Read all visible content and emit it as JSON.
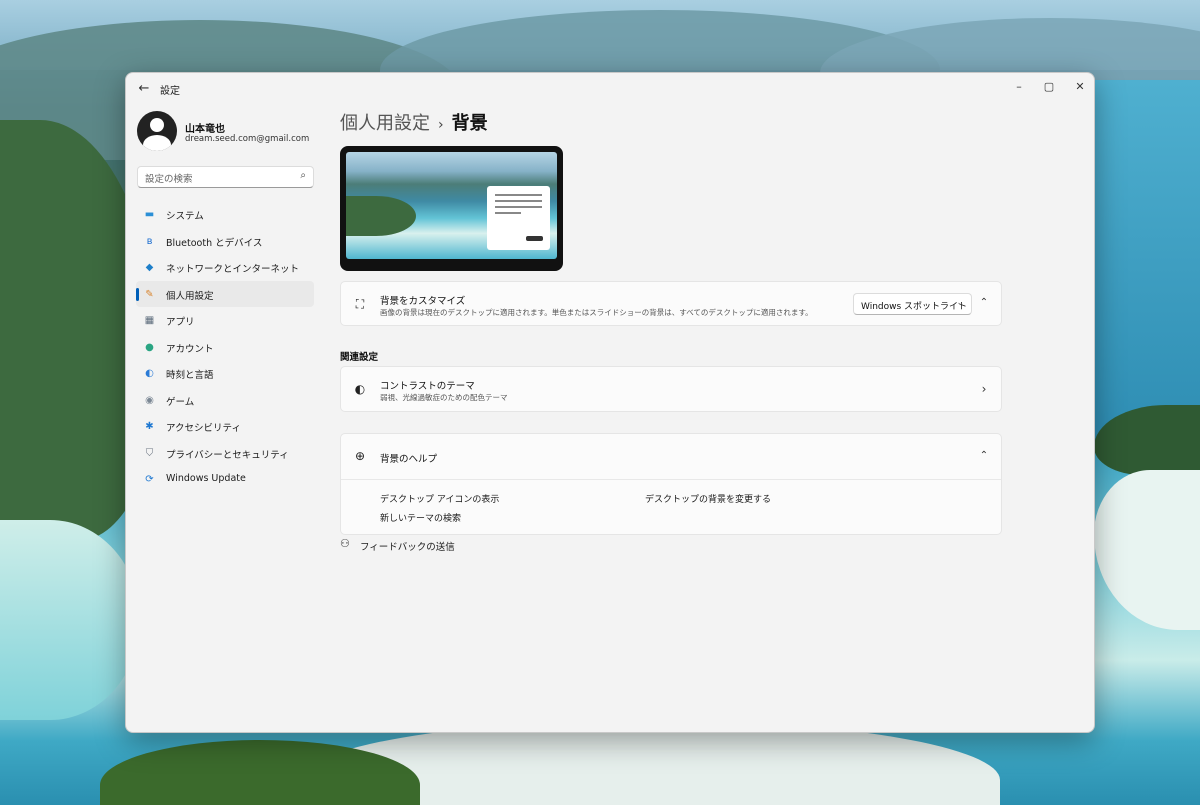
{
  "window": {
    "app_title": "設定",
    "back_glyph": "←",
    "controls": {
      "minimize": "–",
      "maximize": "▢",
      "close": "✕"
    }
  },
  "user": {
    "name": "山本竜也",
    "email": "dream.seed.com@gmail.com"
  },
  "search": {
    "placeholder": "設定の検索",
    "icon": "🔍"
  },
  "sidebar": {
    "items": [
      {
        "label": "システム",
        "icon": "▬",
        "color": "#2b8fd6"
      },
      {
        "label": "Bluetooth とデバイス",
        "icon": "ʙ",
        "color": "#1e6fd0"
      },
      {
        "label": "ネットワークとインターネット",
        "icon": "◆",
        "color": "#1e7fc9"
      },
      {
        "label": "個人用設定",
        "icon": "✎",
        "color": "#d9852f",
        "active": true
      },
      {
        "label": "アプリ",
        "icon": "▦",
        "color": "#5a6a7a"
      },
      {
        "label": "アカウント",
        "icon": "●",
        "color": "#2aa583"
      },
      {
        "label": "時刻と言語",
        "icon": "◐",
        "color": "#2b7bd6"
      },
      {
        "label": "ゲーム",
        "icon": "◉",
        "color": "#7b8794"
      },
      {
        "label": "アクセシビリティ",
        "icon": "✱",
        "color": "#1f78d1"
      },
      {
        "label": "プライバシーとセキュリティ",
        "icon": "⛉",
        "color": "#6b7480"
      },
      {
        "label": "Windows Update",
        "icon": "⟳",
        "color": "#1f78d1"
      }
    ]
  },
  "breadcrumb": {
    "parent": "個人用設定",
    "separator": "›",
    "current": "背景"
  },
  "background_card": {
    "icon": "🖼",
    "title": "背景をカスタマイズ",
    "subtitle": "画像の背景は現在のデスクトップに適用されます。単色またはスライドショーの背景は、すべてのデスクトップに適用されます。",
    "dropdown_value": "Windows スポットライト",
    "dropdown_chevron": "⌄",
    "collapse_chevron": "⌃"
  },
  "related": {
    "section_label": "関連設定",
    "contrast": {
      "icon": "◐",
      "title": "コントラストのテーマ",
      "subtitle": "弱視、光線過敏症のための配色テーマ",
      "chevron": "›"
    }
  },
  "help": {
    "icon": "🌐",
    "title": "背景のヘルプ",
    "chevron": "⌃",
    "links": [
      "デスクトップ アイコンの表示",
      "デスクトップの背景を変更する",
      "新しいテーマの検索"
    ]
  },
  "feedback": {
    "icon": "👤",
    "label": "フィードバックの送信"
  },
  "accent": "#005fb8"
}
